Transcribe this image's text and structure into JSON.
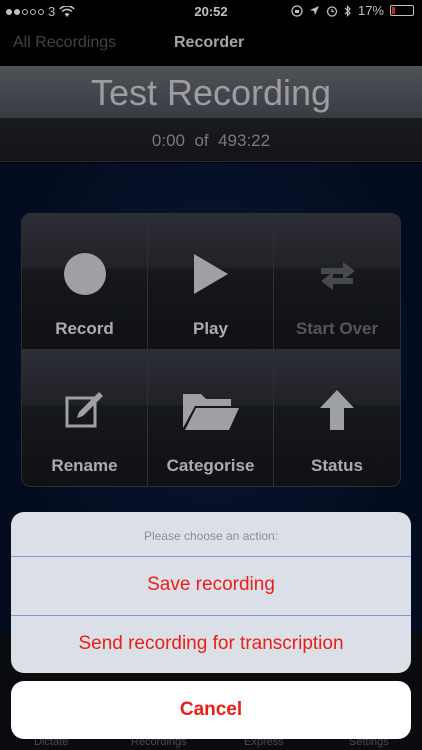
{
  "status_bar": {
    "carrier": "3",
    "time": "20:52",
    "battery": "17%",
    "battery_level": 0.17
  },
  "nav": {
    "back_label": "All Recordings",
    "title": "Recorder"
  },
  "recording": {
    "title": "Test Recording",
    "position": "0:00",
    "of": "of",
    "duration": "493:22"
  },
  "controls": [
    {
      "label": "Record",
      "icon": "record-icon",
      "enabled": true
    },
    {
      "label": "Play",
      "icon": "play-icon",
      "enabled": true
    },
    {
      "label": "Start Over",
      "icon": "start-over-icon",
      "enabled": false
    },
    {
      "label": "Rename",
      "icon": "rename-icon",
      "enabled": true
    },
    {
      "label": "Categorise",
      "icon": "folder-icon",
      "enabled": true
    },
    {
      "label": "Status",
      "icon": "upload-arrow-icon",
      "enabled": true
    }
  ],
  "tabs": [
    "Dictate",
    "Recordings",
    "Express",
    "Settings"
  ],
  "action_sheet": {
    "prompt": "Please choose an action:",
    "options": [
      "Save recording",
      "Send recording for transcription"
    ],
    "cancel": "Cancel"
  },
  "colors": {
    "destructive": "#e8201a",
    "background_blue": "#06112a"
  }
}
